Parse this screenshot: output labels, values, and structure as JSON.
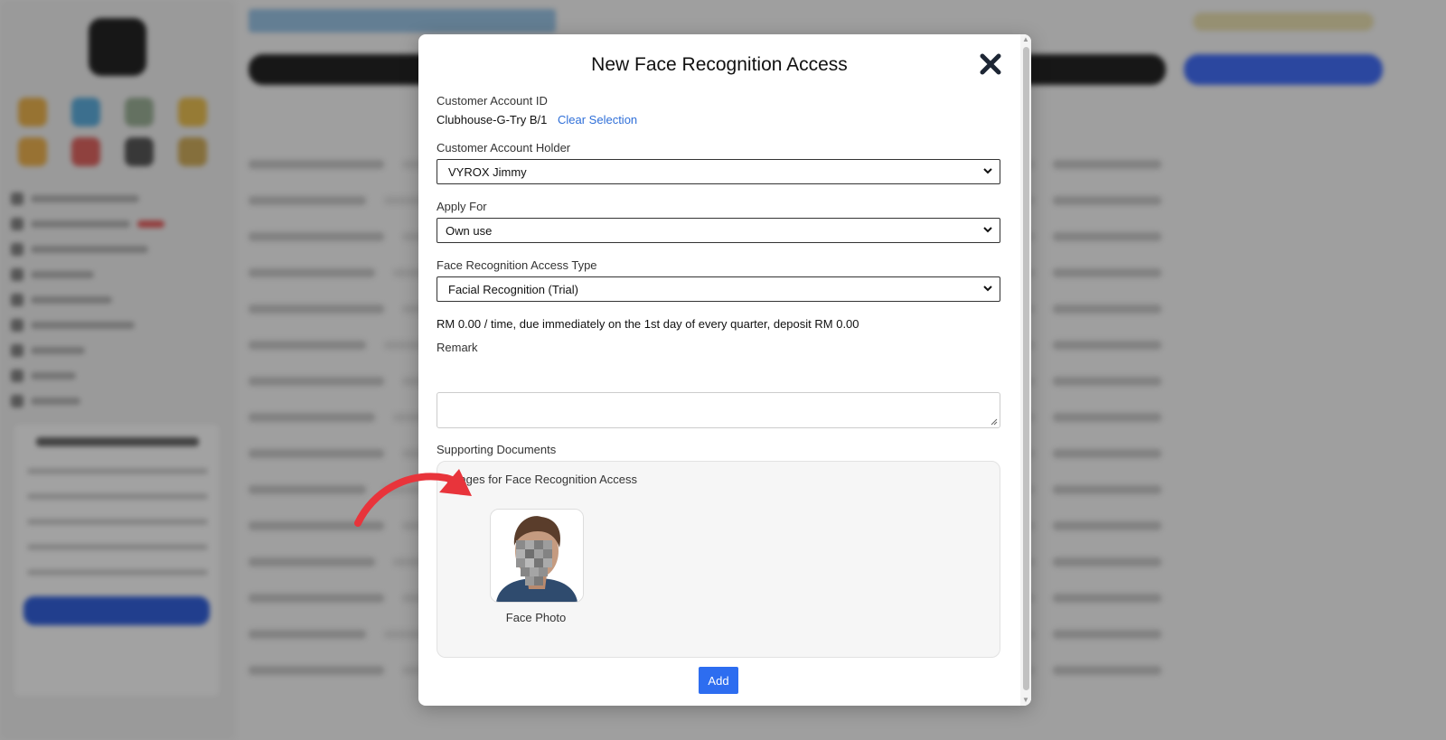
{
  "modal": {
    "title": "New Face Recognition Access",
    "customer_account_id": {
      "label": "Customer Account ID",
      "value": "Clubhouse-G-Try B/1",
      "clear_link": "Clear Selection"
    },
    "customer_account_holder": {
      "label": "Customer Account Holder",
      "value": "VYROX Jimmy"
    },
    "apply_for": {
      "label": "Apply For",
      "value": "Own use"
    },
    "access_type": {
      "label": "Face Recognition Access Type",
      "value": "Facial Recognition (Trial)"
    },
    "fee_note": "RM 0.00 / time, due immediately on the 1st day of every quarter, deposit RM 0.00",
    "remark": {
      "label": "Remark",
      "value": ""
    },
    "supporting_documents": {
      "label": "Supporting Documents",
      "caption": "Images for Face Recognition Access",
      "photo_caption": "Face Photo"
    },
    "add_label": "Add"
  },
  "colors": {
    "primary": "#2d6df0",
    "link": "#2f6fd8",
    "annotation_arrow": "#e8343b"
  },
  "icons": [
    "close-icon",
    "chevron-down-icon",
    "resize-grip-icon",
    "annotation-arrow"
  ]
}
